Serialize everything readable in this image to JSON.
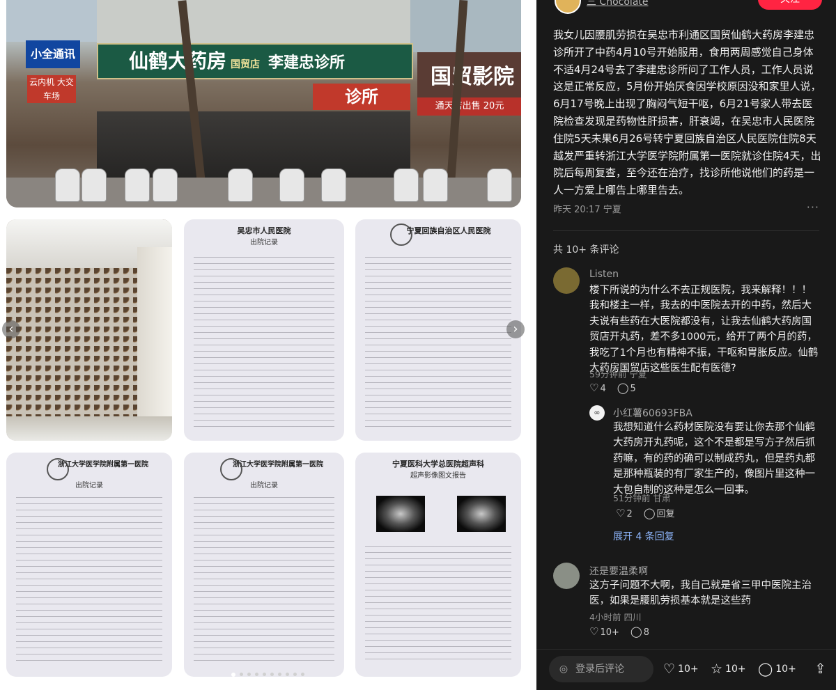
{
  "gallery": {
    "street_signs": {
      "pharmacy": "仙鹤大药房",
      "branch": "国贸店",
      "clinic": "李建忠诊所",
      "clinic_cross": "诊所",
      "left_blue": "小全通讯",
      "left_red": "云内机 大交车场",
      "right_building": "国贸影院",
      "right_banner": "通天店出售 20元"
    },
    "doc1": {
      "title": "吴忠市人民医院",
      "subtitle": "出院记录"
    },
    "doc2": {
      "title": "宁夏回族自治区人民医院",
      "subtitle": ""
    },
    "doc3": {
      "title": "浙江大学医学院附属第一医院",
      "subtitle": "出院记录"
    },
    "doc4": {
      "title": "浙江大学医学院附属第一医院",
      "subtitle": "出院记录"
    },
    "doc5": {
      "title": "宁夏医科大学总医院超声科",
      "subtitle": "超声影像图文报告"
    },
    "carousel": {
      "prev": "‹",
      "next": "›",
      "total_dots": 10,
      "active_index": 0
    }
  },
  "post": {
    "author": "三 Chocolate",
    "follow_label": "关注",
    "body": "我女儿因腰肌劳损在吴忠市利通区国贸仙鹤大药房李建忠诊所开了中药4月10号开始服用，食用两周感觉自己身体不适4月24号去了李建忠诊所问了工作人员，工作人员说这是正常反应，5月份开始厌食因学校原因没和家里人说，6月17号晚上出现了胸闷气短干呕，6月21号家人带去医院检查发现是药物性肝损害，肝衰竭，在吴忠市人民医院住院5天未果6月26号转宁夏回族自治区人民医院住院8天越发严重转浙江大学医学院附属第一医院就诊住院4天，出院后每周复查，至今还在治疗，找诊所他说他们的药是一人一方爱上哪告上哪里告去。",
    "time": "昨天 20:17",
    "location": "宁夏",
    "more": "···",
    "comment_count": "共 10+ 条评论"
  },
  "comments": [
    {
      "name": "Listen",
      "text": "楼下所说的为什么不去正规医院，我来解释！！！我和楼主一样，我去的中医院去开的中药，然后大夫说有些药在大医院都没有，让我去仙鹤大药房国贸店开丸药，差不多1000元，给开了两个月的药，我吃了1个月也有精神不振，干呕和胃胀反应。仙鹤大药房国贸店这些医生配有医德?",
      "time": "59分钟前",
      "location": "宁夏",
      "likes": "4",
      "replies": "5",
      "avatar_color": "#7a6a32"
    },
    {
      "name": "小红薯60693FBA",
      "text": "我想知道什么药材医院没有要让你去那个仙鹤大药房开丸药呢，这个不是都是写方子然后抓药嘛，有的药的确可以制成药丸，但是药丸都是那种瓶装的有厂家生产的，像图片里这种一大包自制的这种是怎么一回事。",
      "time": "51分钟前",
      "location": "甘肃",
      "likes": "2",
      "reply_label": "回复",
      "avatar_color": "#f2f2f2"
    },
    {
      "name": "还是要温柔啊",
      "text": "这方子问题不大啊，我自己就是省三甲中医院主治医，如果是腰肌劳损基本就是这些药",
      "time": "4小时前",
      "location": "四川",
      "likes": "10+",
      "replies": "8",
      "avatar_color": "#8a8f86"
    }
  ],
  "expand_replies": "展开 4 条回复",
  "bottom_bar": {
    "input_placeholder": "登录后评论",
    "likes": "10+",
    "stars": "10+",
    "comments": "10+"
  },
  "colors": {
    "accent": "#ff2442",
    "panel_bg": "#191919",
    "link": "#8fb8ff"
  }
}
